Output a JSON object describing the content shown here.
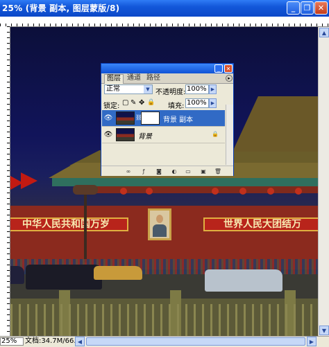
{
  "window": {
    "title": "25% (背景 副本, 图层蒙版/8)",
    "controls": [
      "minimize-icon",
      "restore-icon",
      "close-icon"
    ]
  },
  "status": {
    "zoom": "25%",
    "doc_size": "文档:34.7M/66.8M"
  },
  "canvas": {
    "banner_left": "中华人民共和国万岁",
    "banner_right": "世界人民大团结万"
  },
  "layers_panel": {
    "tabs": [
      "图层",
      "通道",
      "路径"
    ],
    "blend_mode": "正常",
    "opacity_label": "不透明度:",
    "opacity_value": "100%",
    "lock_label": "锁定:",
    "fill_label": "填充:",
    "fill_value": "100%",
    "layers": [
      {
        "name": "背景 副本",
        "selected": true,
        "has_mask": true
      },
      {
        "name": "背景",
        "selected": false,
        "locked": true
      }
    ],
    "bottom_icons": [
      "link-layers-icon",
      "layer-style-icon",
      "add-mask-icon",
      "adjustment-layer-icon",
      "new-group-icon",
      "new-layer-icon",
      "delete-layer-icon"
    ]
  },
  "colors": {
    "titlebar": "#0b48c8",
    "selected_layer": "#316ac5",
    "wall_red": "#8b2a1e"
  }
}
